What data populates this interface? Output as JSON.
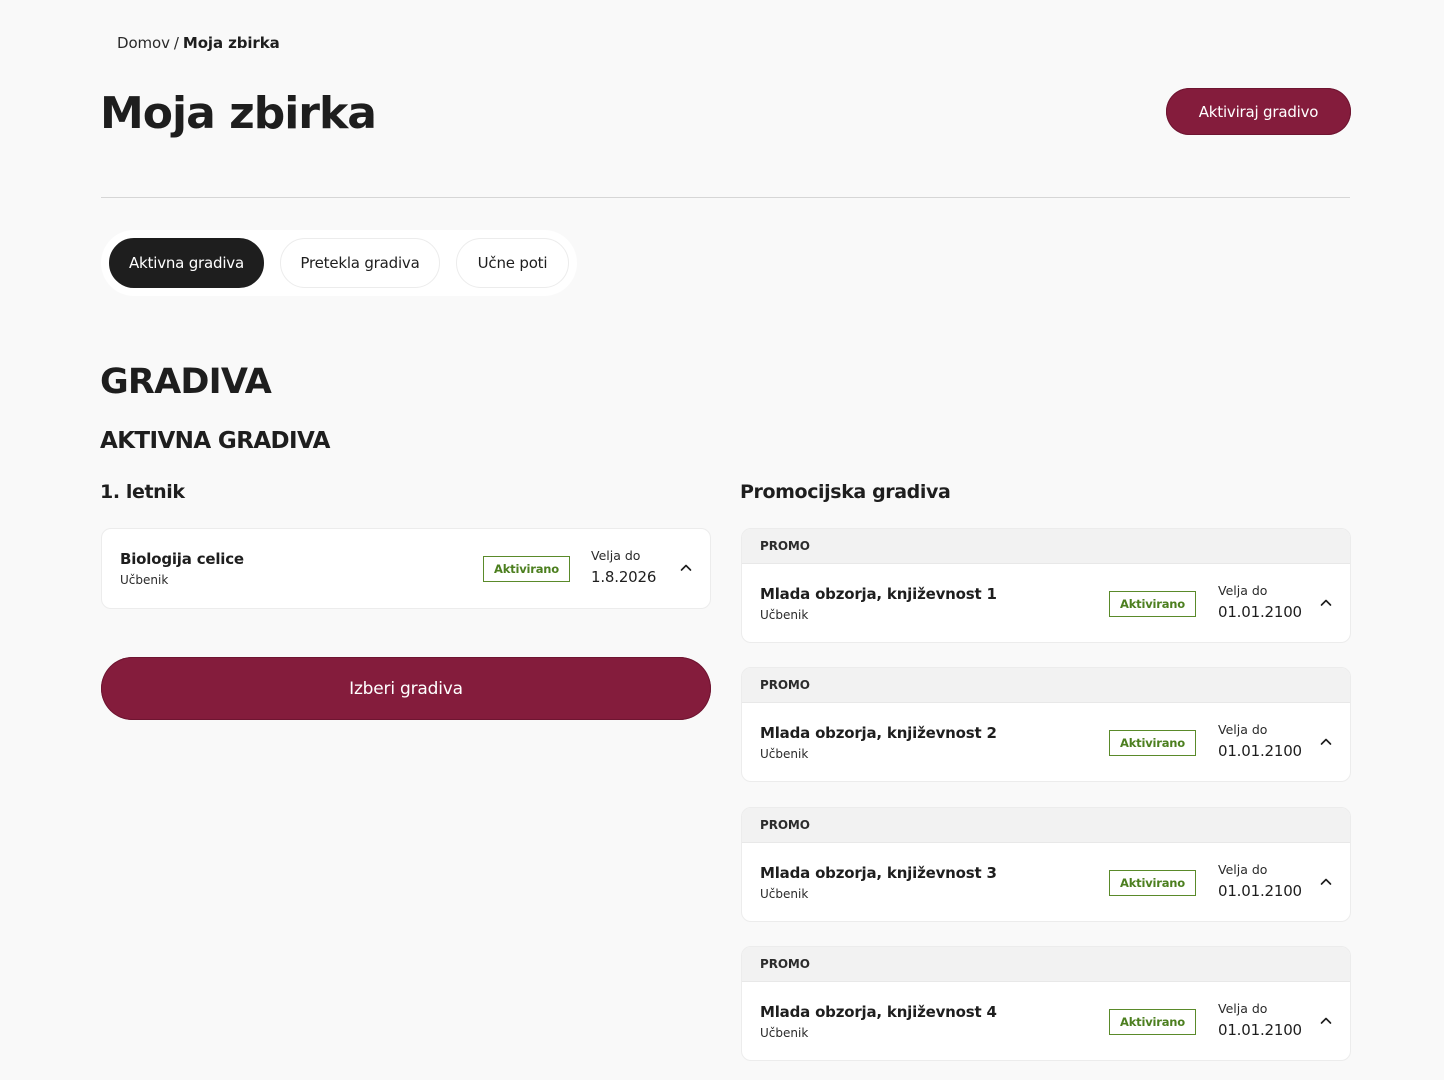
{
  "breadcrumb": {
    "home": "Domov",
    "separator": "/",
    "current": "Moja zbirka"
  },
  "page_title": "Moja zbirka",
  "header": {
    "activate_label": "Aktiviraj gradivo"
  },
  "tabs": [
    {
      "label": "Aktivna gradiva",
      "active": true
    },
    {
      "label": "Pretekla gradiva",
      "active": false
    },
    {
      "label": "Učne poti",
      "active": false
    }
  ],
  "section": {
    "title": "GRADIVA",
    "subtitle": "AKTIVNA GRADIVA"
  },
  "left_column": {
    "title": "1. letnik",
    "items": [
      {
        "title": "Biologija celice",
        "type": "Učbenik",
        "status": "Aktivirano",
        "valid_label": "Velja do",
        "valid_until": "1.8.2026"
      }
    ],
    "select_label": "Izberi gradiva"
  },
  "right_column": {
    "title": "Promocijska gradiva",
    "items": [
      {
        "tag": "PROMO",
        "title": "Mlada obzorja, književnost 1",
        "type": "Učbenik",
        "status": "Aktivirano",
        "valid_label": "Velja do",
        "valid_until": "01.01.2100"
      },
      {
        "tag": "PROMO",
        "title": "Mlada obzorja, književnost 2",
        "type": "Učbenik",
        "status": "Aktivirano",
        "valid_label": "Velja do",
        "valid_until": "01.01.2100"
      },
      {
        "tag": "PROMO",
        "title": "Mlada obzorja, književnost 3",
        "type": "Učbenik",
        "status": "Aktivirano",
        "valid_label": "Velja do",
        "valid_until": "01.01.2100"
      },
      {
        "tag": "PROMO",
        "title": "Mlada obzorja, književnost 4",
        "type": "Učbenik",
        "status": "Aktivirano",
        "valid_label": "Velja do",
        "valid_until": "01.01.2100"
      }
    ]
  },
  "icons": {
    "expand": "chevron-up-icon"
  },
  "colors": {
    "brand": "#841c3c",
    "active_tab": "#1e1e1e",
    "status_green": "#4c7f1f",
    "background": "#f9f9f9"
  }
}
